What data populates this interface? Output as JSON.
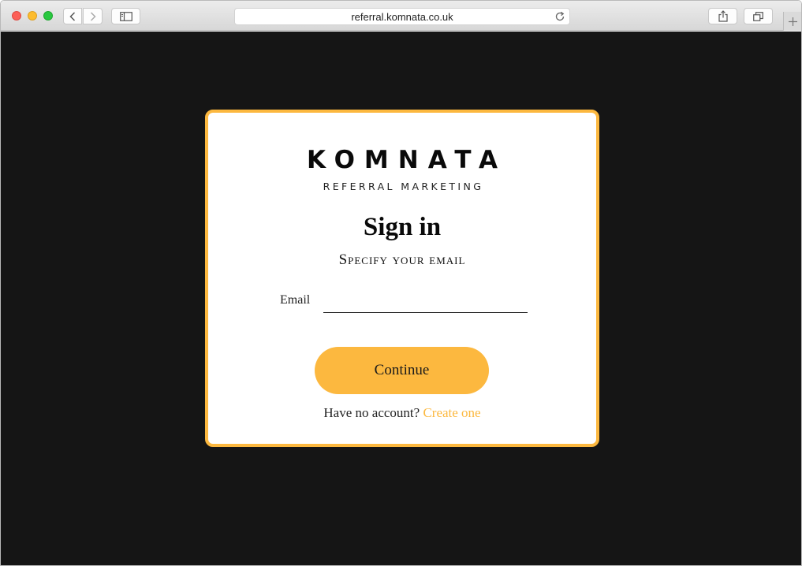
{
  "browser": {
    "url": "referral.komnata.co.uk",
    "icons": {
      "back": "chevron-left-icon",
      "forward": "chevron-right-icon",
      "sidebar": "sidebar-icon",
      "reload": "reload-icon",
      "share": "share-icon",
      "tabs": "tabs-icon",
      "new_tab": "plus-icon"
    }
  },
  "card": {
    "brand": "KOMNATA",
    "tagline": "REFERRAL MARKETING",
    "title": "Sign in",
    "subtitle": "Specify your email",
    "email_label": "Email",
    "email_value": "",
    "email_placeholder": "",
    "continue_label": "Continue",
    "signup_prompt": "Have no account?",
    "signup_link": "Create one"
  },
  "colors": {
    "accent": "#fcb83f",
    "background": "#151515",
    "card": "#ffffff"
  }
}
